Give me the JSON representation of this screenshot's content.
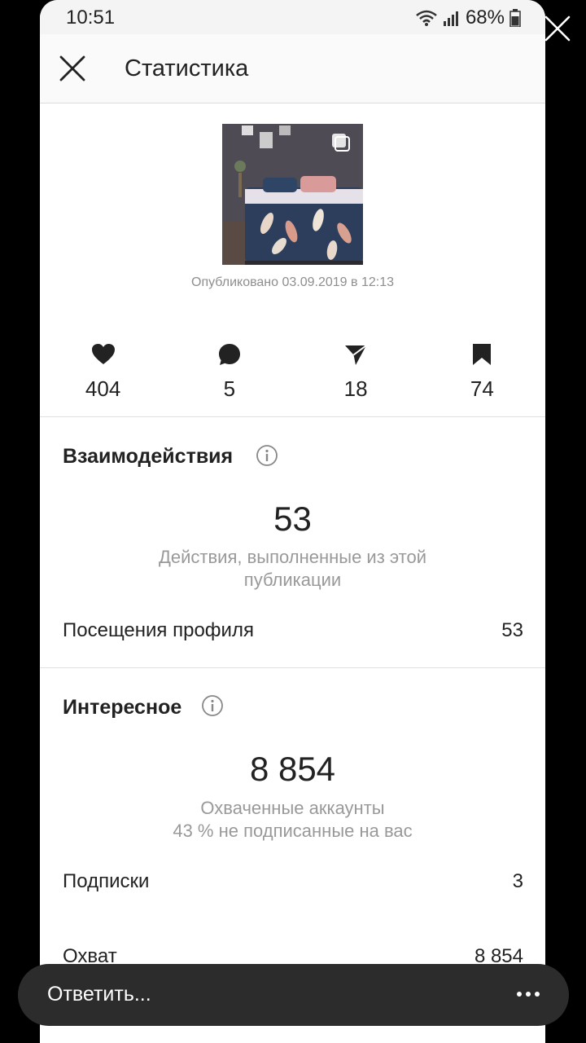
{
  "status_bar": {
    "time": "10:51",
    "battery": "68%"
  },
  "header": {
    "title": "Статистика"
  },
  "post": {
    "published": "Опубликовано 03.09.2019 в 12:13"
  },
  "metrics": [
    {
      "icon": "heart-icon",
      "value": "404"
    },
    {
      "icon": "comment-icon",
      "value": "5"
    },
    {
      "icon": "send-icon",
      "value": "18"
    },
    {
      "icon": "bookmark-icon",
      "value": "74"
    }
  ],
  "interactions": {
    "title": "Взаимодействия",
    "value": "53",
    "description": "Действия, выполненные из этой публикации",
    "rows": [
      {
        "label": "Посещения профиля",
        "value": "53"
      }
    ]
  },
  "discovery": {
    "title": "Интересное",
    "value": "8 854",
    "description_line1": "Охваченные аккаунты",
    "description_line2": "43 % не подписанные на вас",
    "rows": [
      {
        "label": "Подписки",
        "value": "3"
      },
      {
        "label": "Охват",
        "value": "8 854"
      }
    ]
  },
  "reply": {
    "placeholder": "Ответить..."
  }
}
